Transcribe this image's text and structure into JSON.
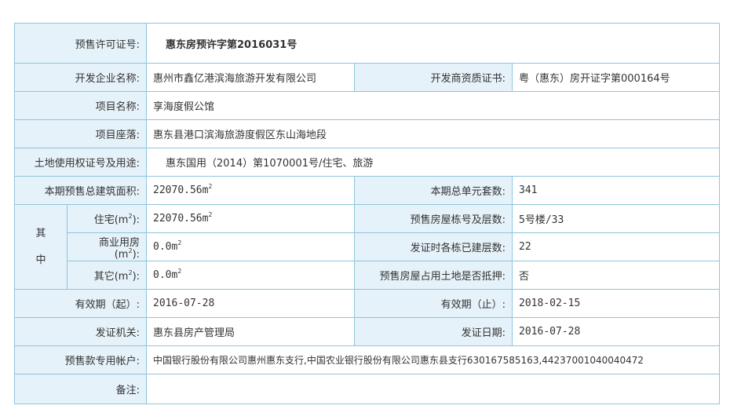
{
  "permit": {
    "title_label": "预售许可证号:",
    "title_value": "惠东房预许字第2016031号"
  },
  "rows": {
    "developer_label": "开发企业名称:",
    "developer_value": "惠州市鑫亿港滨海旅游开发有限公司",
    "qualification_label": "开发商资质证书:",
    "qualification_value": "粤（惠东）房开证字第000164号",
    "project_name_label": "项目名称:",
    "project_name_value": "享海度假公馆",
    "location_label": "项目座落:",
    "location_value": "惠东县港口滨海旅游度假区东山海地段",
    "land_label": "土地使用权证号及用途:",
    "land_value": "惠东国用（2014）第1070001号/住宅、旅游",
    "total_area_label": "本期预售总建筑面积:",
    "total_area_value": "22070.56m",
    "total_units_label": "本期总单元套数:",
    "total_units_value": "341",
    "qizhong_1": "其",
    "qizhong_2": "中",
    "residential_label": "住宅(m",
    "residential_value": "22070.56m",
    "building_floors_label": "预售房屋栋号及层数:",
    "building_floors_value": "5号楼/33",
    "commercial_label": "商业用房(m",
    "commercial_value": "0.0m",
    "built_floors_label": "发证时各栋已建层数:",
    "built_floors_value": "22",
    "other_label": "其它(m",
    "other_value": "0.0m",
    "mortgage_label": "预售房屋占用土地是否抵押:",
    "mortgage_value": "否",
    "valid_from_label": "有效期（起）:",
    "valid_from_value": "2016-07-28",
    "valid_to_label": "有效期（止）:",
    "valid_to_value": "2018-02-15",
    "issuer_label": "发证机关:",
    "issuer_value": "惠东县房产管理局",
    "issue_date_label": "发证日期:",
    "issue_date_value": "2016-07-28",
    "account_label": "预售款专用帐户:",
    "account_value": "中国银行股份有限公司惠州惠东支行,中国农业银行股份有限公司惠东县支行630167585163,44237001040040472",
    "note_label": "备注:",
    "note_value": ""
  },
  "units": {
    "sq": "2",
    "paren_close": "):"
  }
}
